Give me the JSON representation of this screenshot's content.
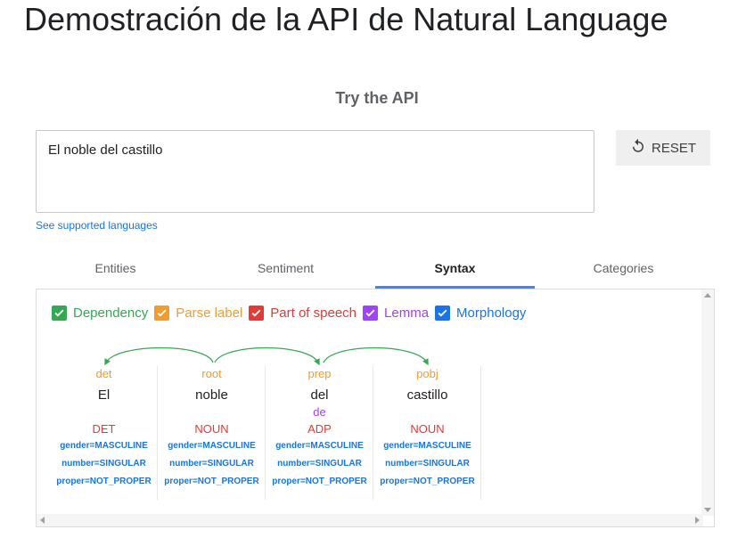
{
  "page": {
    "title": "Demostración de la API de Natural Language"
  },
  "section": {
    "title": "Try the API"
  },
  "input": {
    "value": "El noble del castillo"
  },
  "reset": {
    "label": "RESET",
    "icon": "reset-icon"
  },
  "link": {
    "label": "See supported languages"
  },
  "tabs": [
    {
      "label": "Entities"
    },
    {
      "label": "Sentiment"
    },
    {
      "label": "Syntax",
      "active": true
    },
    {
      "label": "Categories"
    }
  ],
  "legend": [
    {
      "label": "Dependency",
      "color": "#34a853",
      "checked": true
    },
    {
      "label": "Parse label",
      "color": "#f29c2b",
      "checked": true
    },
    {
      "label": "Part of speech",
      "color": "#e53935",
      "checked": true
    },
    {
      "label": "Lemma",
      "color": "#a142f4",
      "checked": true
    },
    {
      "label": "Morphology",
      "color": "#1a73e8",
      "checked": true
    }
  ],
  "tokens": [
    {
      "label": "det",
      "word": "El",
      "lemma": "",
      "pos": "DET",
      "morph": [
        "gender=MASCULINE",
        "number=SINGULAR",
        "proper=NOT_PROPER"
      ]
    },
    {
      "label": "root",
      "word": "noble",
      "lemma": "",
      "pos": "NOUN",
      "morph": [
        "gender=MASCULINE",
        "number=SINGULAR",
        "proper=NOT_PROPER"
      ]
    },
    {
      "label": "prep",
      "word": "del",
      "lemma": "de",
      "pos": "ADP",
      "morph": [
        "gender=MASCULINE",
        "number=SINGULAR",
        "proper=NOT_PROPER"
      ]
    },
    {
      "label": "pobj",
      "word": "castillo",
      "lemma": "",
      "pos": "NOUN",
      "morph": [
        "gender=MASCULINE",
        "number=SINGULAR",
        "proper=NOT_PROPER"
      ]
    }
  ],
  "dependencies": [
    {
      "from": 1,
      "to": 0
    },
    {
      "from": 1,
      "to": 2
    },
    {
      "from": 2,
      "to": 3
    }
  ]
}
